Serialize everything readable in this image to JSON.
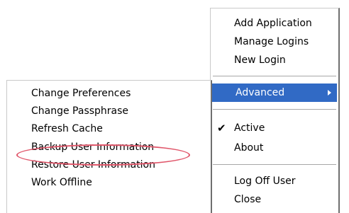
{
  "main_menu": {
    "items": [
      {
        "label": "Add Application"
      },
      {
        "label": "Manage Logins"
      },
      {
        "label": "New Login"
      },
      {
        "label": "Advanced"
      },
      {
        "label": "Active",
        "checked": true
      },
      {
        "label": "About"
      },
      {
        "label": "Log Off User"
      },
      {
        "label": "Close"
      }
    ]
  },
  "submenu": {
    "items": [
      {
        "label": "Change Preferences"
      },
      {
        "label": "Change Passphrase"
      },
      {
        "label": "Refresh Cache"
      },
      {
        "label": "Backup User Information"
      },
      {
        "label": "Restore User Information"
      },
      {
        "label": "Work Offline"
      }
    ]
  },
  "colors": {
    "highlight": "#316ac5",
    "annotation_circle": "#e0566a"
  }
}
